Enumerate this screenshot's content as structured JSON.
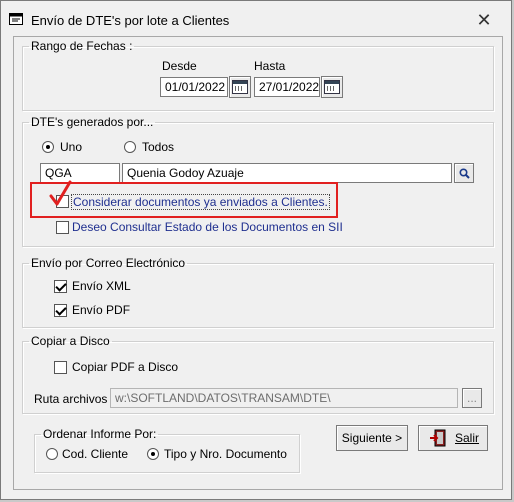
{
  "window": {
    "title": "Envío de DTE's por lote a Clientes"
  },
  "date_range": {
    "legend": "Rango de Fechas :",
    "from_label": "Desde",
    "from_value": "01/01/2022",
    "to_label": "Hasta",
    "to_value": "27/01/2022"
  },
  "dte_generated": {
    "legend": "DTE's generados por...",
    "radio_one": "Uno",
    "radio_all": "Todos",
    "client_code": "QGA",
    "client_name": "Quenia Godoy Azuaje",
    "consider_sent": "Considerar documentos ya enviados a Clientes.",
    "consult_state": "Deseo Consultar Estado de los Documentos en SII"
  },
  "email": {
    "legend": "Envío por Correo Electrónico",
    "xml": "Envío XML",
    "pdf": "Envío PDF"
  },
  "disk": {
    "legend": "Copiar a Disco",
    "copy_pdf": "Copiar PDF a Disco",
    "path_label": "Ruta archivos :",
    "path_value": "w:\\SOFTLAND\\DATOS\\TRANSAM\\DTE\\",
    "browse": "..."
  },
  "order": {
    "legend": "Ordenar Informe Por:",
    "by_client": "Cod. Cliente",
    "by_type": "Tipo y Nro. Documento"
  },
  "buttons": {
    "next": "Siguiente >",
    "exit": "Salir"
  },
  "colors": {
    "annotation": "#e12020",
    "link_text": "#1f2f8f"
  }
}
